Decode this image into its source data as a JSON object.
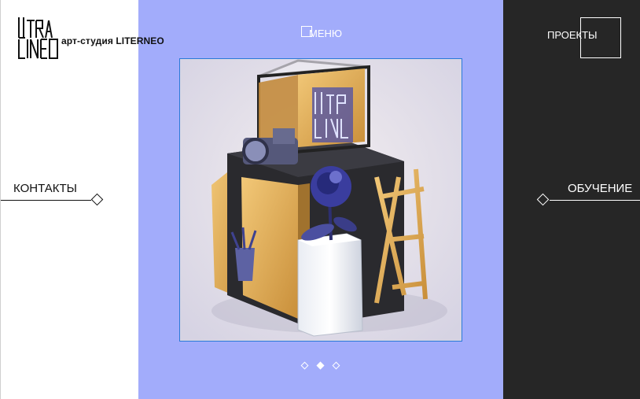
{
  "header": {
    "studio_name": "арт-студия LITERNEO",
    "menu_label": "МЕНЮ",
    "projects_label": "ПРОЕКТЫ"
  },
  "sidebar_left": {
    "contacts_label": "КОНТАКТЫ"
  },
  "sidebar_right": {
    "education_label": "ОБУЧЕНИЕ"
  },
  "slider": {
    "slide_count": 3,
    "active_index": 1,
    "image_description": "3D render: glass cube with LITERNEO logo, camera, blue rose on glass pedestal, gold easel, pencil cup"
  },
  "colors": {
    "center_bg": "#a2acfb",
    "right_bg": "#262626",
    "left_bg": "#ffffff",
    "frame_border": "#2a7ad8",
    "accent_gold": "#e3b15c",
    "accent_blue": "#3a3d9e"
  },
  "icons": [
    "logo-mark",
    "menu-square-icon",
    "projects-square-icon",
    "diamond-icon"
  ]
}
